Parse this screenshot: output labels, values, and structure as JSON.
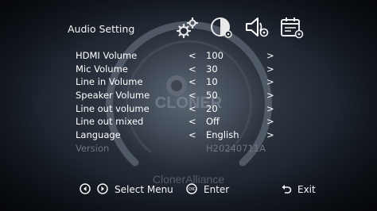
{
  "header": {
    "title": "Audio Setting",
    "tabs": [
      {
        "icon": "gears-icon"
      },
      {
        "icon": "display-settings-icon"
      },
      {
        "icon": "speaker-settings-icon"
      },
      {
        "icon": "calendar-settings-icon"
      }
    ]
  },
  "settings": [
    {
      "label": "HDMI Volume",
      "left": "<",
      "value": "100",
      "right": ">"
    },
    {
      "label": "Mic Volume",
      "left": "<",
      "value": "30",
      "right": ">"
    },
    {
      "label": "Line in Volume",
      "left": "<",
      "value": "10",
      "right": ">"
    },
    {
      "label": "Speaker Volume",
      "left": "<",
      "value": "50",
      "right": ">"
    },
    {
      "label": "Line out volume",
      "left": "<",
      "value": "20",
      "right": ">"
    },
    {
      "label": "Line out mixed",
      "left": "<",
      "value": "Off",
      "right": ">"
    },
    {
      "label": "Language",
      "left": "<",
      "value": "English",
      "right": ">"
    },
    {
      "label": "Version",
      "value": "H20240711A"
    }
  ],
  "footer": {
    "select_label": "Select Menu",
    "enter_label": "Enter",
    "exit_label": "Exit"
  },
  "watermark": {
    "logo_text": "CLONER",
    "brand_text": "ClonerAlliance"
  },
  "colors": {
    "text": "#ffffff",
    "disabled": "#6d7480",
    "background": "#2a323d"
  }
}
